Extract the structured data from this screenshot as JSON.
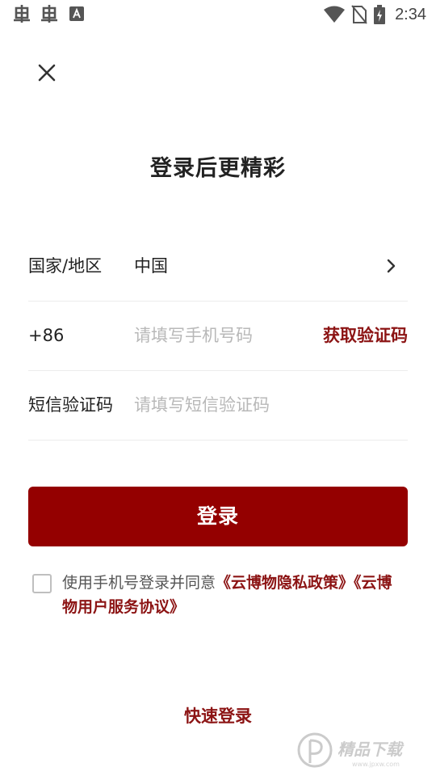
{
  "status_bar": {
    "time": "2:34",
    "left_icons": [
      "bug-icon",
      "bug-icon",
      "a-badge-icon"
    ],
    "right_icons": [
      "wifi-icon",
      "no-sim-icon",
      "battery-charging-icon"
    ]
  },
  "header": {
    "close_icon": "close-icon",
    "title": "登录后更精彩"
  },
  "form": {
    "region": {
      "label": "国家/地区",
      "value": "中国",
      "chevron_icon": "chevron-right-icon"
    },
    "phone": {
      "prefix": "+86",
      "value": "",
      "placeholder": "请填写手机号码",
      "get_code_label": "获取验证码"
    },
    "code": {
      "label": "短信验证码",
      "value": "",
      "placeholder": "请填写短信验证码"
    }
  },
  "login_button": {
    "label": "登录"
  },
  "agreement": {
    "checked": false,
    "prefix": "使用手机号登录并同意",
    "privacy_link": "《云博物隐私政策》",
    "service_link": "《云博物用户服务协议》"
  },
  "quick_login": {
    "label": "快速登录"
  },
  "colors": {
    "accent": "#940000",
    "link": "#8c1414",
    "placeholder": "#b8b8b8",
    "divider": "#ececec"
  },
  "watermark": {
    "text": "精品下载",
    "subtext": "www.jpxw.com"
  }
}
